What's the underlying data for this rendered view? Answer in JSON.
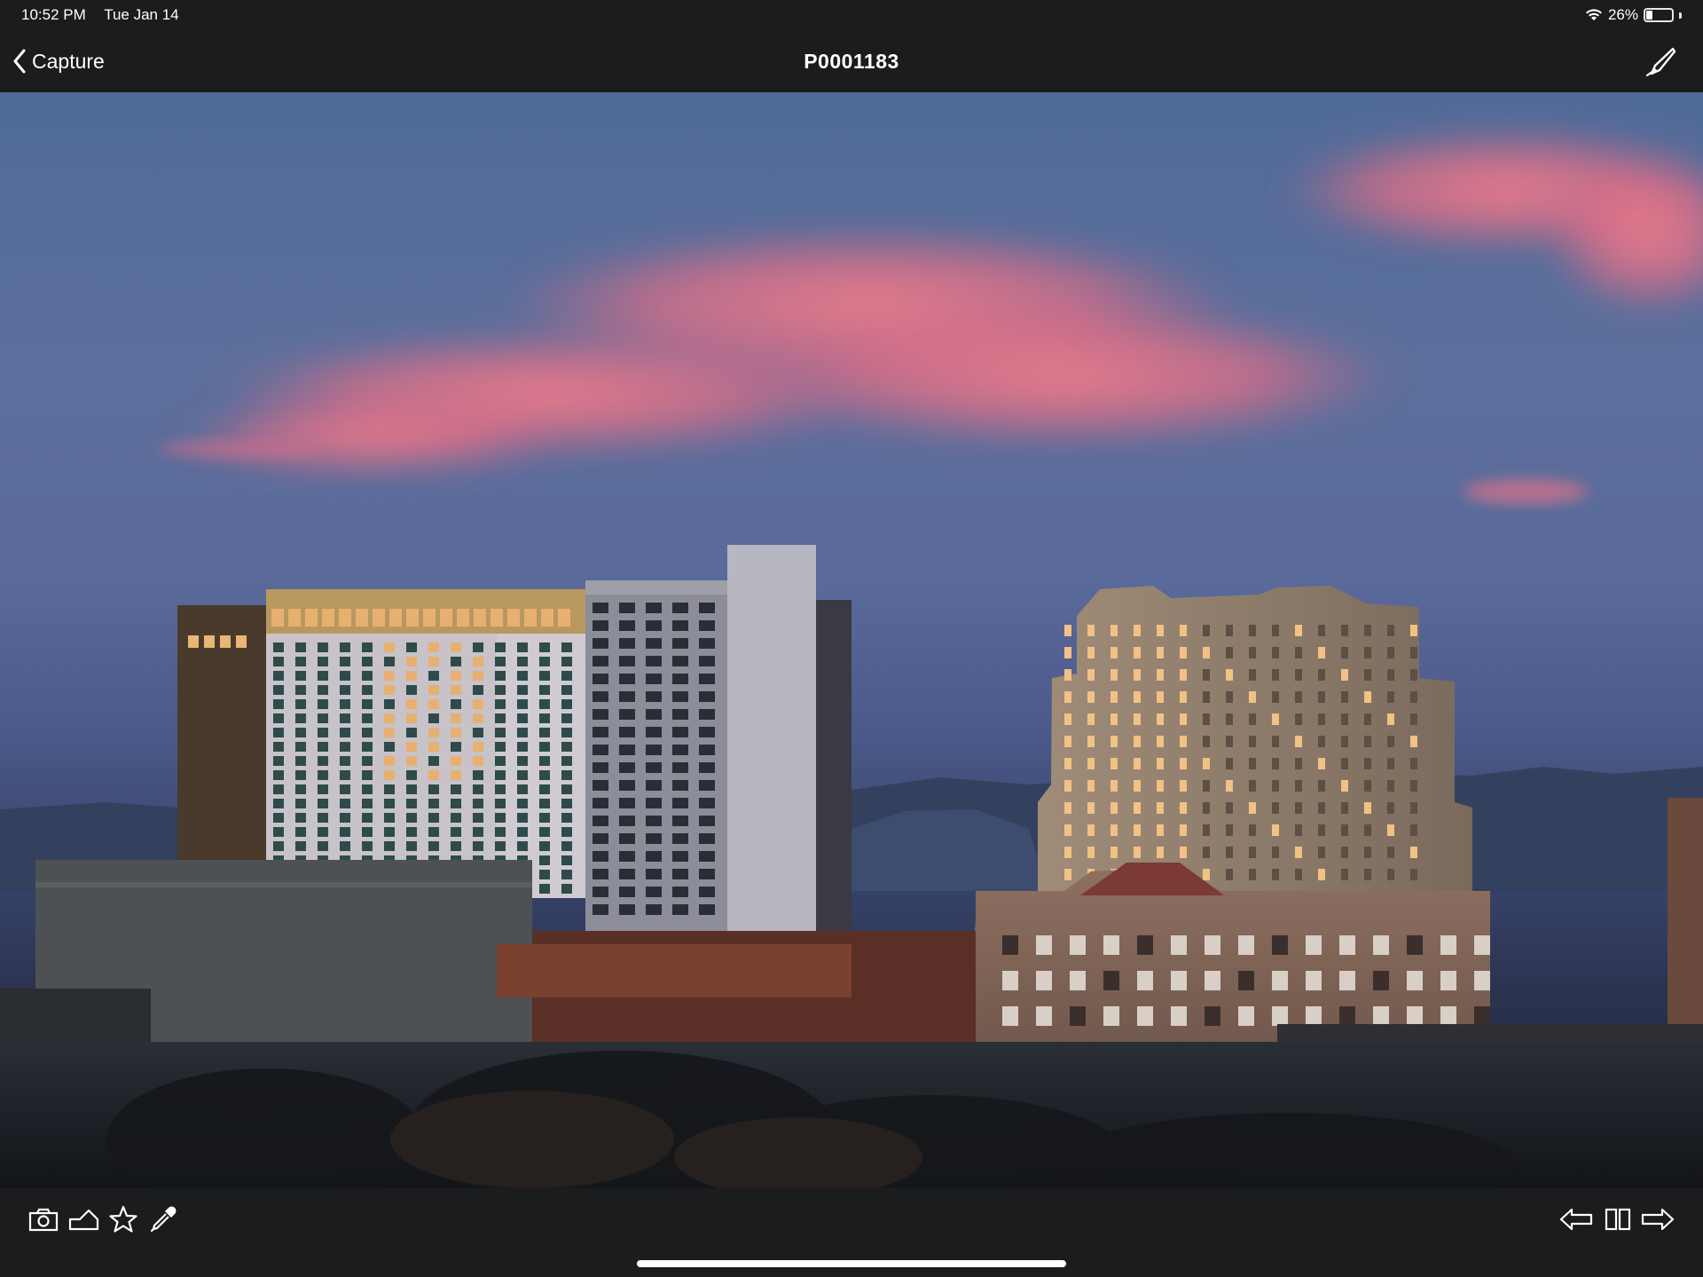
{
  "status_bar": {
    "time": "10:52 PM",
    "date": "Tue Jan 14",
    "battery_percent": "26%",
    "battery_level": 0.26
  },
  "nav": {
    "back_label": "Capture",
    "title": "P0001183"
  },
  "photo": {
    "subject": "city skyline at dusk"
  },
  "toolbar": {
    "left_icons": [
      "camera-icon",
      "exposure-icon",
      "star-icon",
      "eyedropper-icon"
    ],
    "right_icons": [
      "previous-arrow-icon",
      "compare-icon",
      "next-arrow-icon"
    ]
  },
  "colors": {
    "bar_background": "#1b1c1e",
    "text": "#ffffff",
    "sky_top": "#4f6a98",
    "cloud_pink": "#e9788a"
  }
}
